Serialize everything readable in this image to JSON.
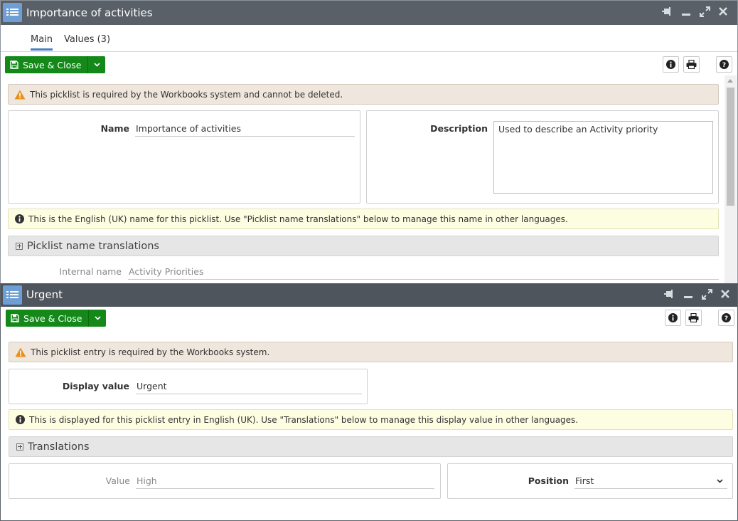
{
  "window1": {
    "title": "Importance of activities",
    "tabs": [
      {
        "label": "Main"
      },
      {
        "label": "Values (3)"
      }
    ],
    "save_label": "Save & Close",
    "warning": "This picklist is required by the Workbooks system and cannot be deleted.",
    "name_label": "Name",
    "name_value": "Importance of activities",
    "description_label": "Description",
    "description_value": "Used to describe an Activity priority",
    "info": "This is the English (UK) name for this picklist. Use \"Picklist name translations\" below to manage this name in other languages.",
    "section_label": "Picklist name translations",
    "internal_name_label": "Internal name",
    "internal_name_value": "Activity Priorities"
  },
  "window2": {
    "title": "Urgent",
    "save_label": "Save & Close",
    "warning": "This picklist entry is required by the Workbooks system.",
    "display_value_label": "Display value",
    "display_value": "Urgent",
    "info": "This is displayed for this picklist entry in English (UK). Use \"Translations\" below to manage this display value in other languages.",
    "section_label": "Translations",
    "value_label": "Value",
    "value": "High",
    "position_label": "Position",
    "position_value": "First"
  },
  "colors": {
    "titlebar": "#5a6068",
    "save_green": "#14891a",
    "tab_accent": "#4a7ebb",
    "warning_bg": "#efe6dd",
    "info_bg": "#fdfde1",
    "warning_icon": "#e8901c"
  }
}
